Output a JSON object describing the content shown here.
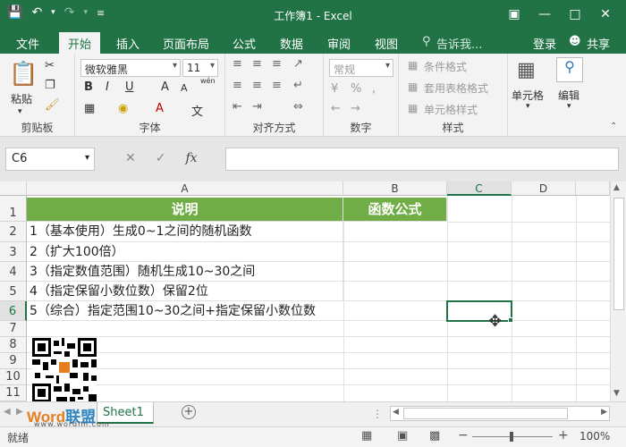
{
  "window": {
    "title": "工作簿1 - Excel"
  },
  "qat": {
    "save_icon": "save-icon",
    "undo_icon": "undo-icon",
    "redo_icon": "redo-icon"
  },
  "tabs": [
    {
      "label": "文件"
    },
    {
      "label": "开始"
    },
    {
      "label": "插入"
    },
    {
      "label": "页面布局"
    },
    {
      "label": "公式"
    },
    {
      "label": "数据"
    },
    {
      "label": "审阅"
    },
    {
      "label": "视图"
    },
    {
      "label": "告诉我..."
    }
  ],
  "account": {
    "login": "登录",
    "share": "共享"
  },
  "ribbon": {
    "clipboard": {
      "label": "剪贴板",
      "paste": "粘贴"
    },
    "font": {
      "label": "字体",
      "name": "微软雅黑",
      "size": "11",
      "bold": "B",
      "italic": "I",
      "underline": "U",
      "grow": "A",
      "shrink": "A",
      "wen": "wén"
    },
    "alignment": {
      "label": "对齐方式"
    },
    "number": {
      "label": "数字",
      "format": "常规"
    },
    "styles": {
      "label": "样式",
      "conditional": "条件格式",
      "table": "套用表格格式",
      "cell_styles": "单元格样式"
    },
    "cells": {
      "label": "单元格"
    },
    "editing": {
      "label": "编辑"
    }
  },
  "formula_bar": {
    "name_box": "C6",
    "fx": "fx",
    "value": ""
  },
  "columns": [
    "A",
    "B",
    "C",
    "D"
  ],
  "rows": [
    "1",
    "2",
    "3",
    "4",
    "5",
    "6",
    "7",
    "8",
    "9",
    "10",
    "11"
  ],
  "cells": {
    "A1": "说明",
    "B1": "函数公式",
    "A2": "1（基本使用）生成0~1之间的随机函数",
    "A3": "2（扩大100倍）",
    "A4": "3（指定数值范围）随机生成10~30之间",
    "A5": "4（指定保留小数位数）保留2位",
    "A6": "5（综合）指定范围10~30之间+指定保留小数位数"
  },
  "sheets": [
    {
      "name": "Sheet1",
      "active": true
    }
  ],
  "status": {
    "ready": "就绪",
    "zoom": "100%"
  },
  "watermark": {
    "brand_a": "Word",
    "brand_b": "联盟",
    "url": "www.wordlm.com"
  },
  "colors": {
    "accent": "#217346",
    "header_fill": "#70ad47"
  }
}
